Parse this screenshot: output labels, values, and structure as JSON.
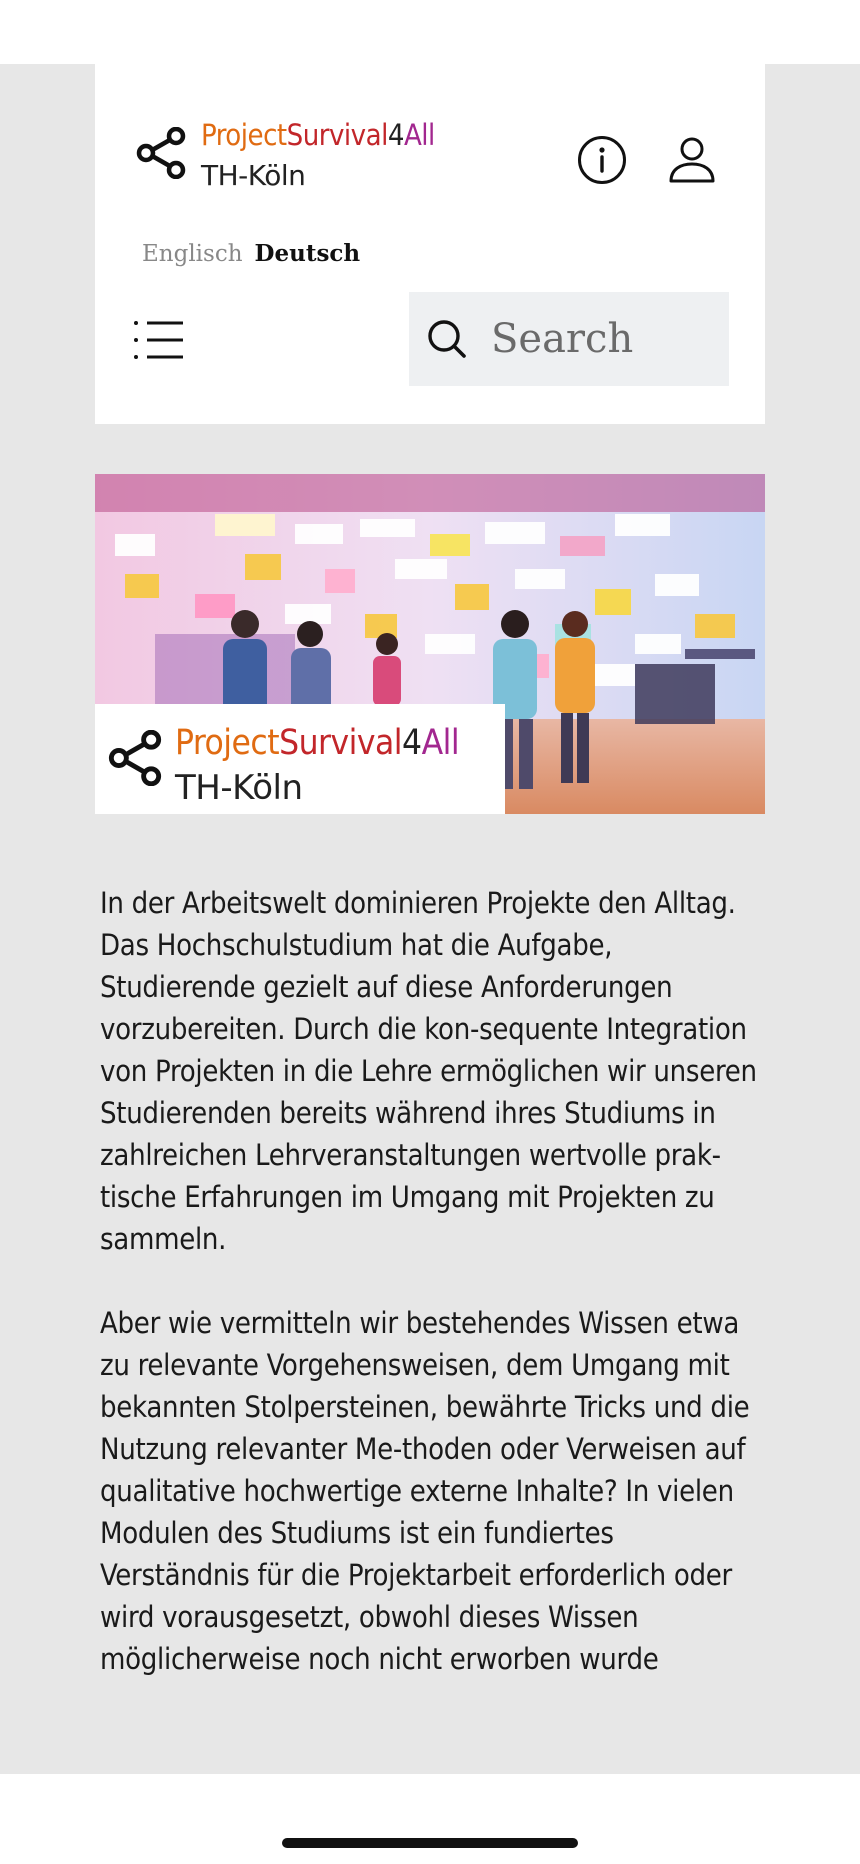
{
  "brand": {
    "part1": "Project",
    "part2": "Survival",
    "part3": "4",
    "part4": "All",
    "university": "TH-Köln"
  },
  "languages": {
    "english": "Englisch",
    "german": "Deutsch",
    "selected": "Deutsch"
  },
  "search": {
    "placeholder": "Search"
  },
  "icons": {
    "share": "share-icon",
    "info": "info-icon",
    "user": "user-icon",
    "menu": "menu-icon",
    "search": "search-icon"
  },
  "colors": {
    "project": "#e06b12",
    "survival": "#c2262a",
    "four": "#222222",
    "all": "#a2278f",
    "page_background": "#e7e7e7"
  },
  "content": {
    "paragraph1": "In der Arbeitswelt dominieren Projekte den Alltag. Das Hochschulstudium hat die Aufgabe, Studierende gezielt auf diese Anforderungen vorzubereiten. Durch die kon-sequente Integration von Projekten in die Lehre ermöglichen wir unseren Studierenden bereits während ihres Studiums in zahlreichen Lehrveranstaltungen wertvolle prak-tische Erfahrungen im Umgang mit Projekten zu sammeln.",
    "paragraph2": "Aber wie vermitteln wir bestehendes Wissen etwa zu relevante Vorgehensweisen, dem Umgang mit bekannten Stolpersteinen, bewährte Tricks und die Nutzung relevanter Me-thoden oder Verweisen auf qualitative hochwertige externe Inhalte? In vielen Modulen des Studiums ist ein fundiertes Verständnis für die Projektarbeit erforderlich oder wird vorausgesetzt, obwohl dieses Wissen möglicherweise noch nicht erworben wurde"
  }
}
